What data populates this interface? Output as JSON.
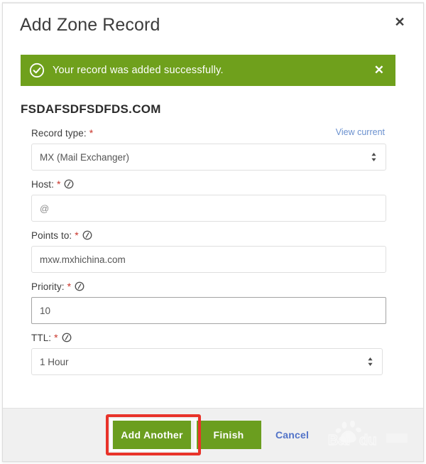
{
  "dialog": {
    "title": "Add Zone Record",
    "close_icon": "close-icon"
  },
  "alert": {
    "icon": "check-circle-icon",
    "message": "Your record was added successfully.",
    "close_icon": "close-icon",
    "background_color": "#6fa01c"
  },
  "domain": {
    "name": "FSDAFSDFSDFDS.COM"
  },
  "form": {
    "view_current_link": "View current",
    "fields": [
      {
        "label": "Record type:",
        "required": "*",
        "control": "select",
        "value": "MX (Mail Exchanger)",
        "has_info_icon": false,
        "has_link": true
      },
      {
        "label": "Host:",
        "required": "*",
        "control": "input",
        "value": "@",
        "has_info_icon": true,
        "has_link": false
      },
      {
        "label": "Points to:",
        "required": "*",
        "control": "input",
        "value": "mxw.mxhichina.com",
        "has_info_icon": true,
        "has_link": false
      },
      {
        "label": "Priority:",
        "required": "*",
        "control": "input",
        "value": "10",
        "has_info_icon": true,
        "has_link": false
      },
      {
        "label": "TTL:",
        "required": "*",
        "control": "select",
        "value": "1 Hour",
        "has_info_icon": true,
        "has_link": false
      }
    ]
  },
  "footer": {
    "add_another_label": "Add Another",
    "finish_label": "Finish",
    "cancel_label": "Cancel",
    "button_color": "#6b9e1f",
    "cancel_color": "#5273c8",
    "highlight_color": "#e8332a"
  },
  "watermark": {
    "text": "Baidu"
  }
}
